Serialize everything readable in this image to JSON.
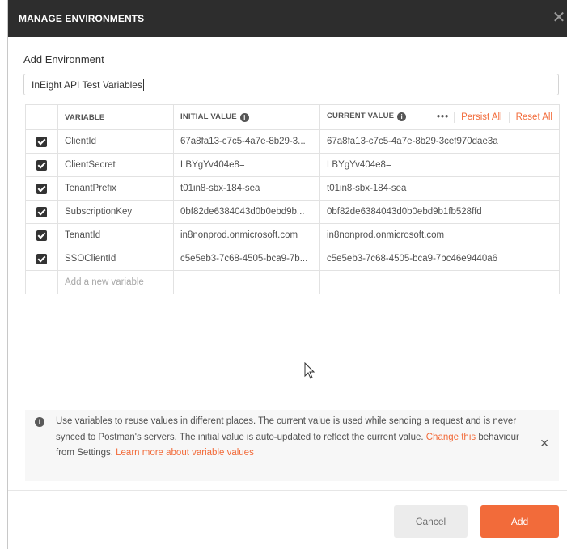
{
  "dialog": {
    "title": "MANAGE ENVIRONMENTS",
    "close_glyph": "✕"
  },
  "form": {
    "section_label": "Add Environment",
    "name_value": "InEight API Test Variables"
  },
  "table": {
    "headers": {
      "variable": "VARIABLE",
      "initial": "INITIAL VALUE",
      "current": "CURRENT VALUE",
      "more": "•••",
      "persist_all": "Persist All",
      "reset_all": "Reset All"
    },
    "rows": [
      {
        "checked": true,
        "variable": "ClientId",
        "initial": "67a8fa13-c7c5-4a7e-8b29-3...",
        "current": "67a8fa13-c7c5-4a7e-8b29-3cef970dae3a"
      },
      {
        "checked": true,
        "variable": "ClientSecret",
        "initial": "LBYgYv404e8=",
        "current": "LBYgYv404e8="
      },
      {
        "checked": true,
        "variable": "TenantPrefix",
        "initial": "t01in8-sbx-184-sea",
        "current": "t01in8-sbx-184-sea"
      },
      {
        "checked": true,
        "variable": "SubscriptionKey",
        "initial": "0bf82de6384043d0b0ebd9b...",
        "current": "0bf82de6384043d0b0ebd9b1fb528ffd"
      },
      {
        "checked": true,
        "variable": "TenantId",
        "initial": "in8nonprod.onmicrosoft.com",
        "current": "in8nonprod.onmicrosoft.com"
      },
      {
        "checked": true,
        "variable": "SSOClientId",
        "initial": "c5e5eb3-7c68-4505-bca9-7b...",
        "current": "c5e5eb3-7c68-4505-bca9-7bc46e9440a6"
      }
    ],
    "new_variable_placeholder": "Add a new variable"
  },
  "notice": {
    "text_1": "Use variables to reuse values in different places. The current value is used while sending a request and is never synced to Postman's servers. The initial value is auto-updated to reflect the current value. ",
    "link_change": "Change this",
    "text_2": " behaviour from Settings. ",
    "link_learn": "Learn more about variable values",
    "close_glyph": "✕"
  },
  "footer": {
    "cancel_label": "Cancel",
    "add_label": "Add"
  },
  "colors": {
    "titlebar_bg": "#2d2d2d",
    "accent": "#f26b3a",
    "notice_bg": "#f7f7f7"
  }
}
